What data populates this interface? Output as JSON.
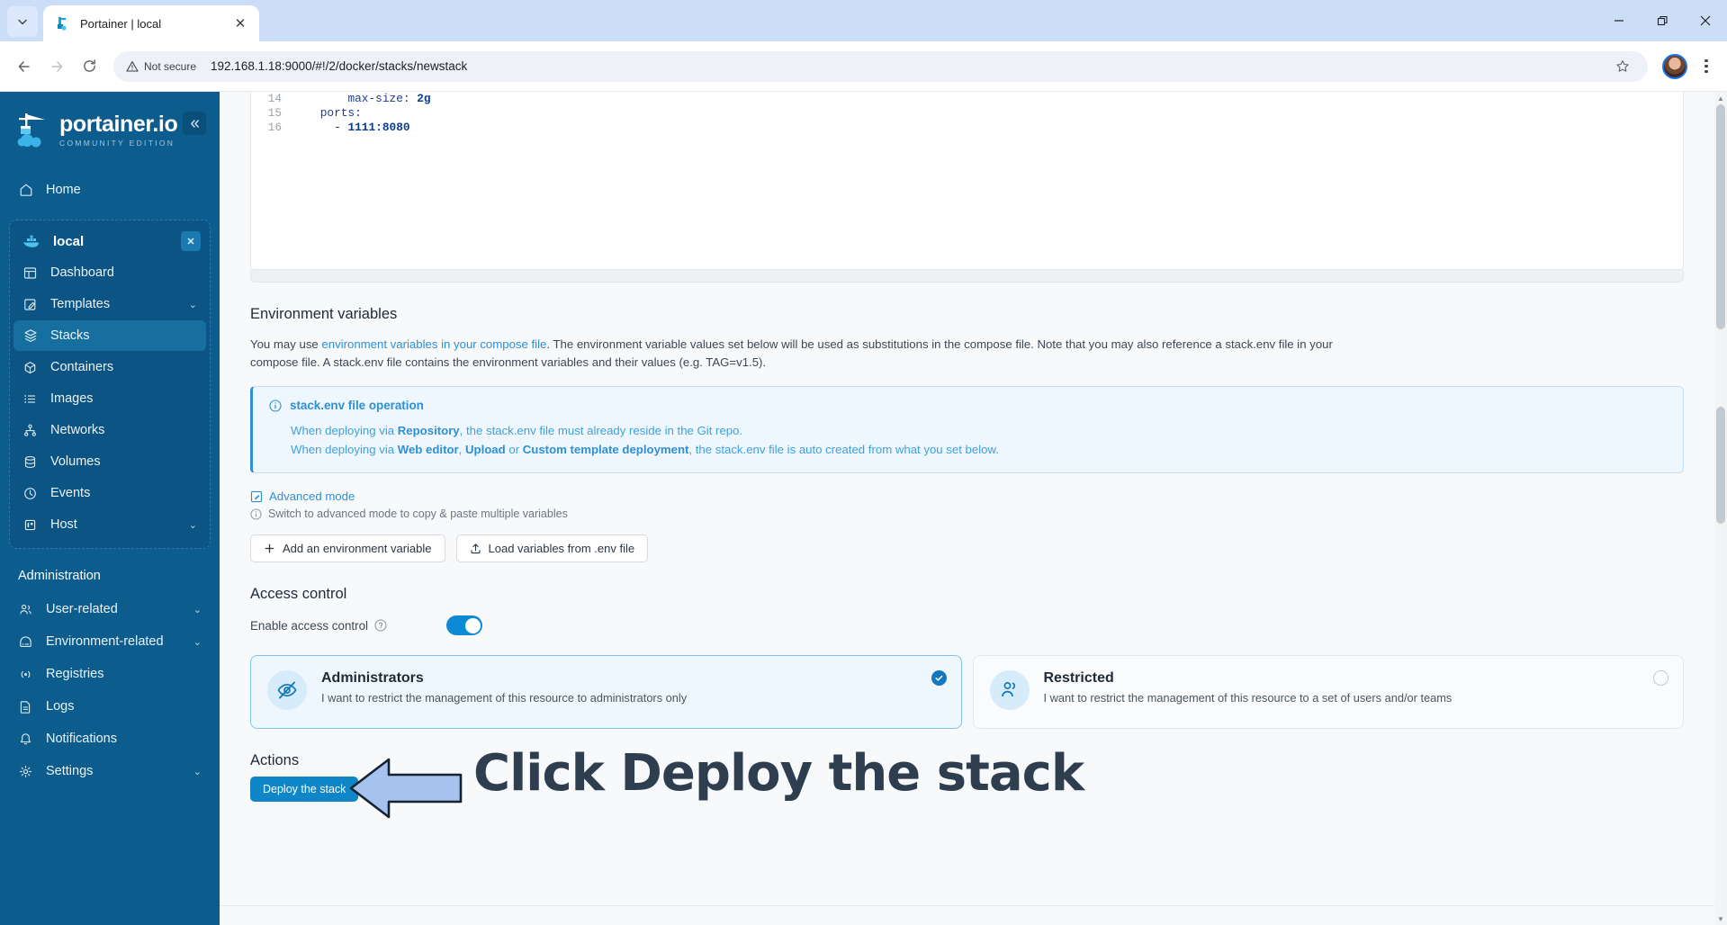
{
  "browser": {
    "tab": {
      "title": "Portainer | local",
      "favicon_icon": "portainer-favicon",
      "close_icon": "close-icon"
    },
    "tab_list_icon": "chevron-down-icon",
    "back_icon": "back-arrow-icon",
    "forward_icon": "forward-arrow-icon",
    "reload_icon": "reload-icon",
    "security": {
      "icon": "warning-triangle-icon",
      "label": "Not secure"
    },
    "url": "192.168.1.18:9000/#!/2/docker/stacks/newstack",
    "star_icon": "bookmark-star-icon",
    "avatar_icon": "profile-avatar",
    "menu_icon": "kebab-menu-icon",
    "window": {
      "minimize_icon": "minimize-icon",
      "maximize_icon": "restore-icon",
      "close_icon": "close-icon"
    }
  },
  "sidebar": {
    "logo": {
      "title": "portainer.io",
      "subtitle": "COMMUNITY EDITION",
      "icon": "portainer-crane-logo"
    },
    "collapse_icon": "chevron-double-left-icon",
    "home": {
      "label": "Home",
      "icon": "home-icon"
    },
    "environment": {
      "name": "local",
      "icon": "docker-whale-icon",
      "close_icon": "close-icon",
      "items": [
        {
          "label": "Dashboard",
          "icon": "dashboard-icon",
          "chevron": "",
          "active": false
        },
        {
          "label": "Templates",
          "icon": "templates-icon",
          "chevron": "⌄",
          "active": false
        },
        {
          "label": "Stacks",
          "icon": "stacks-icon",
          "chevron": "",
          "active": true
        },
        {
          "label": "Containers",
          "icon": "containers-icon",
          "chevron": "",
          "active": false
        },
        {
          "label": "Images",
          "icon": "images-icon",
          "chevron": "",
          "active": false
        },
        {
          "label": "Networks",
          "icon": "networks-icon",
          "chevron": "",
          "active": false
        },
        {
          "label": "Volumes",
          "icon": "volumes-icon",
          "chevron": "",
          "active": false
        },
        {
          "label": "Events",
          "icon": "events-clock-icon",
          "chevron": "",
          "active": false
        },
        {
          "label": "Host",
          "icon": "host-icon",
          "chevron": "⌄",
          "active": false
        }
      ]
    },
    "administration": {
      "title": "Administration",
      "items": [
        {
          "label": "User-related",
          "icon": "users-icon",
          "chevron": "⌄"
        },
        {
          "label": "Environment-related",
          "icon": "environment-icon",
          "chevron": "⌄"
        },
        {
          "label": "Registries",
          "icon": "registries-icon",
          "chevron": ""
        },
        {
          "label": "Logs",
          "icon": "logs-document-icon",
          "chevron": ""
        },
        {
          "label": "Notifications",
          "icon": "bell-icon",
          "chevron": ""
        },
        {
          "label": "Settings",
          "icon": "gear-icon",
          "chevron": "⌄"
        }
      ]
    }
  },
  "editor": {
    "lines": [
      {
        "num": "14",
        "indent": "        ",
        "key": "max-size:",
        "value": " 2g"
      },
      {
        "num": "15",
        "indent": "    ",
        "key": "ports:",
        "value": ""
      },
      {
        "num": "16",
        "indent": "      - ",
        "key": "",
        "value": "1111:8080"
      }
    ]
  },
  "env_vars": {
    "title": "Environment variables",
    "desc_before": "You may use ",
    "desc_link": "environment variables in your compose file",
    "desc_after": ". The environment variable values set below will be used as substitutions in the compose file. Note that you may also reference a stack.env file in your compose file. A stack.env file contains the environment variables and their values (e.g. TAG=v1.5).",
    "info": {
      "icon": "info-circle-icon",
      "title": "stack.env file operation",
      "line1_a": "When deploying via ",
      "line1_b": "Repository",
      "line1_c": ", the stack.env file must already reside in the Git repo.",
      "line2_a": "When deploying via ",
      "line2_b": "Web editor",
      "line2_c": ", ",
      "line2_d": "Upload",
      "line2_e": " or ",
      "line2_f": "Custom template deployment",
      "line2_g": ", the stack.env file is auto created from what you set below."
    },
    "advanced_mode": {
      "label": "Advanced mode",
      "icon": "edit-square-icon"
    },
    "advanced_hint": {
      "label": "Switch to advanced mode to copy & paste multiple variables",
      "icon": "info-circle-icon"
    },
    "buttons": [
      {
        "label": "Add an environment variable",
        "icon": "plus-icon"
      },
      {
        "label": "Load variables from .env file",
        "icon": "upload-icon"
      }
    ]
  },
  "access_control": {
    "title": "Access control",
    "toggle_label": "Enable access control",
    "help_icon": "question-circle-icon",
    "toggle_on": true,
    "options": [
      {
        "title": "Administrators",
        "desc": "I want to restrict the management of this resource to administrators only",
        "icon": "eye-off-icon",
        "selected": true,
        "check_icon": "check-circle-icon"
      },
      {
        "title": "Restricted",
        "desc": "I want to restrict the management of this resource to a set of users and/or teams",
        "icon": "users-group-icon",
        "selected": false,
        "check_icon": "radio-empty-icon"
      }
    ]
  },
  "actions": {
    "title": "Actions",
    "deploy_label": "Deploy the stack",
    "annotation_text": "Click Deploy the stack",
    "annotation_arrow_icon": "left-arrow-annotation",
    "arrow_fill": "#a6c3f0",
    "annotation_color": "#2f3e4f"
  },
  "scrollbar": {
    "up_icon": "chevron-up-icon",
    "down_icon": "chevron-down-icon"
  }
}
